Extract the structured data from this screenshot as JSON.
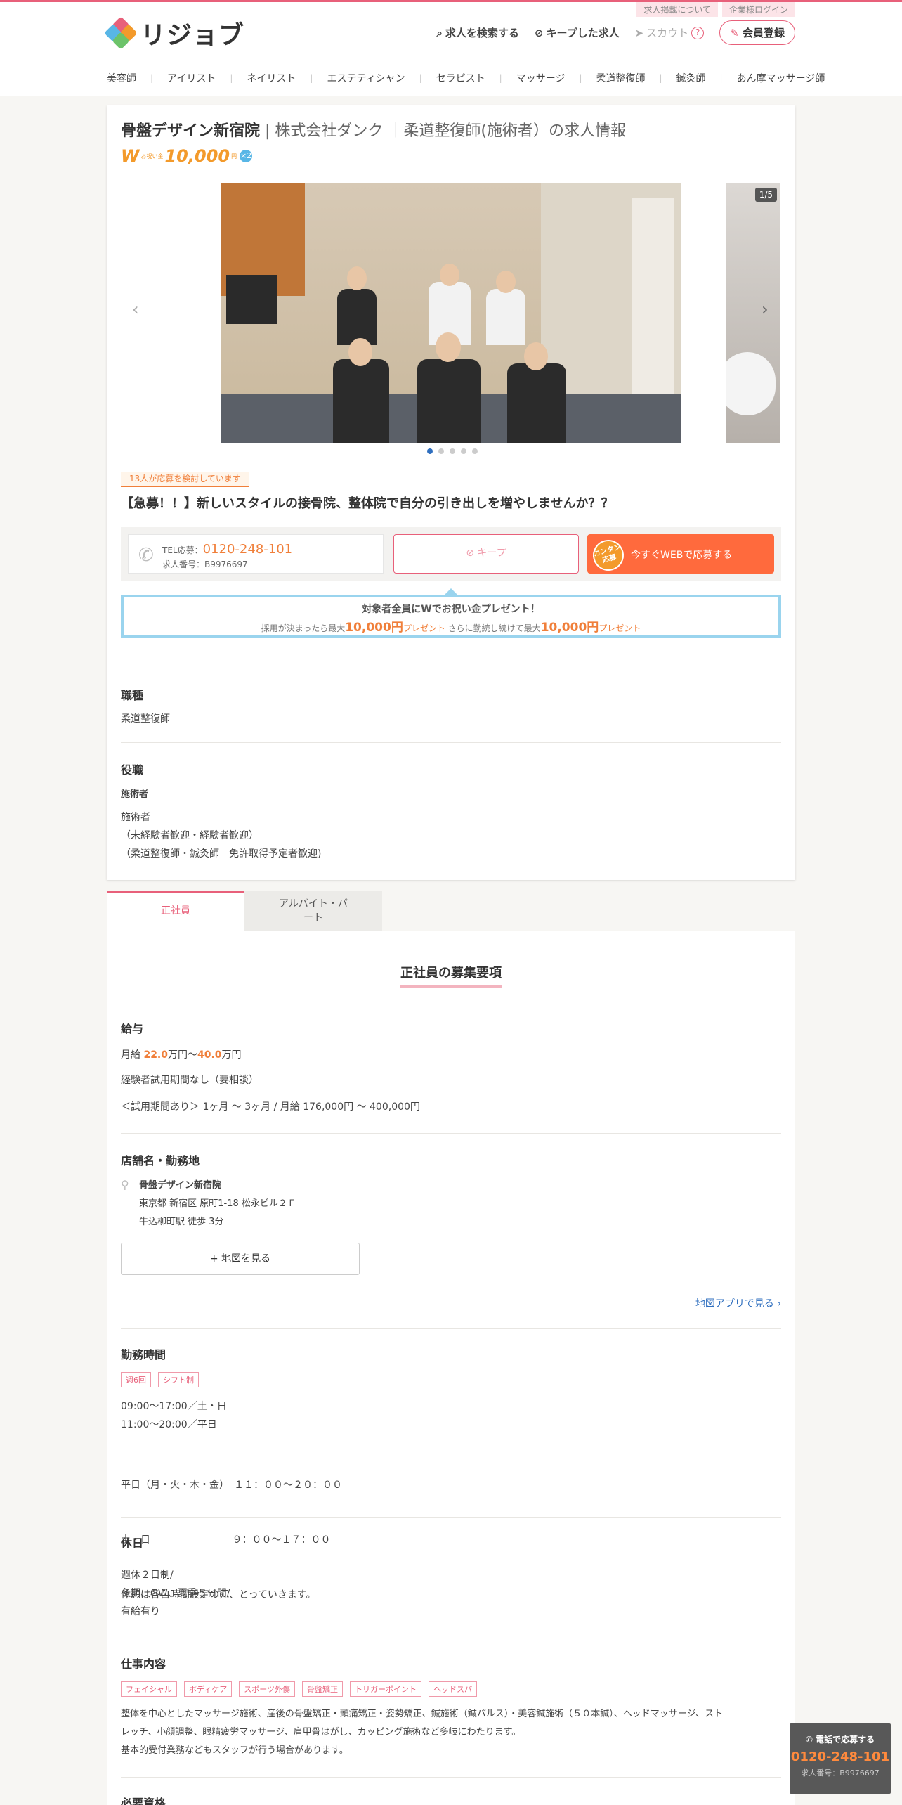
{
  "header": {
    "logo_text": "リジョブ",
    "top_links": [
      "求人掲載について",
      "企業様ログイン"
    ],
    "search_label": "求人を検索する",
    "kept_label": "キープした求人",
    "scout_label": "スカウト",
    "scout_help": "?",
    "register_label": "会員登録",
    "categories": [
      "美容師",
      "アイリスト",
      "ネイリスト",
      "エステティシャン",
      "セラピスト",
      "マッサージ",
      "柔道整復師",
      "鍼灸師",
      "あん摩マッサージ師"
    ]
  },
  "job": {
    "shop_name": "骨盤デザイン新宿院",
    "company_title": "| 株式会社ダンク ｜柔道整復師(施術者）の求人情報",
    "bonus_w": "W",
    "bonus_small": "お祝い金",
    "bonus_amount": "10,000",
    "bonus_unit": "円",
    "bonus_x2": "×2",
    "photo_counter": "1/5",
    "considering": "13人が応募を検討しています",
    "catch": "【急募！！】新しいスタイルの接骨院、整体院で自分の引き出しを増やしませんか？？",
    "tel_prefix": "TEL応募：",
    "tel": "0120-248-101",
    "job_no": "求人番号：B9976697",
    "keep_button": "キープ",
    "web_badge": "カンタン応募",
    "web_button": "今すぐWEBで応募する",
    "present_title": "対象者全員にWでお祝い金プレゼント！",
    "present_a": "採用が決まったら最大",
    "present_amount1": "10,000円",
    "present_b": "プレゼント",
    "present_c": "さらに勤続し続けて最大",
    "present_amount2": "10,000円",
    "present_d": "プレゼント"
  },
  "sections": {
    "occupation_h": "職種",
    "occupation": "柔道整復師",
    "role_h": "役職",
    "role_sub": "施術者",
    "role_lines": [
      "施術者",
      "（未経験者歓迎・経験者歓迎）",
      "（柔道整復師・鍼灸師　免許取得予定者歓迎)"
    ]
  },
  "tabs": [
    "正社員",
    "アルバイト・パート"
  ],
  "detail": {
    "title": "正社員の募集要項",
    "salary_h": "給与",
    "salary_prefix": "月給",
    "salary_min": "22.0",
    "salary_mid": "万円〜",
    "salary_max": "40.0",
    "salary_suffix": "万円",
    "salary_note1": "経験者試用期間なし（要相談）",
    "salary_note2": "＜試用期間あり＞ 1ヶ月 〜 3ヶ月 / 月給 176,000円 〜 400,000円",
    "location_h": "店舗名・勤務地",
    "location_name": "骨盤デザイン新宿院",
    "location_address": "東京都 新宿区 原町1-18 松永ビル２Ｆ",
    "location_station": "牛込柳町駅 徒歩 3分",
    "map_button": "+ 地図を見る",
    "map_app_link": "地図アプリで見る ›",
    "hours_h": "勤務時間",
    "hours_tags": [
      "週6回",
      "シフト制"
    ],
    "hours_lines": [
      "09:00〜17:00／土・日",
      "11:00〜20:00／平日"
    ],
    "hours_detail": [
      "平日（月・火・木・金）　１１：００～２０：００",
      "土・日　　　　　　　　 ９：００～１７：００",
      "休憩は各自時間設定の元、とっていきます。"
    ],
    "holiday_h": "休日",
    "holiday_lines": [
      "週休２日制/",
      "冬期、GW、夏季５日間/",
      "有給有り"
    ],
    "work_h": "仕事内容",
    "work_tags": [
      "フェイシャル",
      "ボディケア",
      "スポーツ外傷",
      "骨盤矯正",
      "トリガーポイント",
      "ヘッドスパ"
    ],
    "work_lines": [
      "整体を中心としたマッサージ施術、産後の骨盤矯正・頭痛矯正・姿勢矯正、鍼施術（鍼パルス）・美容鍼施術（５０本鍼）、ヘッドマッサージ、スト",
      "レッチ、小顔調整、眼精疲労マッサージ、肩甲骨はがし、カッピング施術など多岐にわたります。",
      "基本的受付業務などもスタッフが行う場合があります。"
    ],
    "req_h": "必要資格"
  },
  "sticky": {
    "label": "電話で応募する",
    "tel": "0120-248-101",
    "job_no": "求人番号：B9976697"
  },
  "colors": {
    "accent": "#e8607a",
    "orange": "#f07f3a",
    "blue": "#2f6fbf",
    "present_border": "#9ad4ee"
  }
}
